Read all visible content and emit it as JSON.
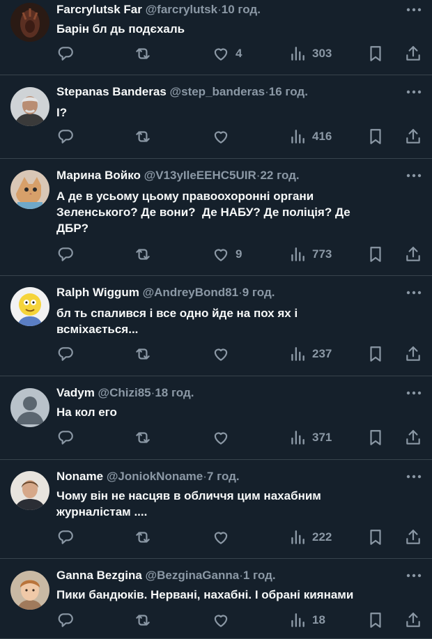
{
  "colors": {
    "background": "#15202b",
    "divider": "#38444d",
    "muted": "#8b98a5",
    "text": "#f7f9f9"
  },
  "tweets": [
    {
      "name": "Farcrylutsk Far",
      "handle": "@farcrylutsk",
      "sep": "·",
      "time": "10 год.",
      "text": "Барін бл дь подєхаль",
      "likes": "4",
      "views": "303",
      "avatar": "dark-figure-avatar"
    },
    {
      "name": "Stepanas Banderas",
      "handle": "@step_banderas",
      "sep": "·",
      "time": "16 год.",
      "text": "І?",
      "likes": "",
      "views": "416",
      "avatar": "man-gray-hair-avatar"
    },
    {
      "name": "Марина Войко",
      "handle": "@V13yIleEEHC5UIR",
      "sep": "·",
      "time": "22 год.",
      "text": "А де в усьому цьому правоохоронні органи\nЗеленського? Де вони?  Де НАБУ? Де поліція? Де\nДБР?",
      "likes": "9",
      "views": "773",
      "avatar": "kitten-avatar"
    },
    {
      "name": "Ralph Wiggum",
      "handle": "@AndreyBond81",
      "sep": "·",
      "time": "9 год.",
      "text": "бл ть спалився і все одно йде на пох ях і\nвсміхається...",
      "likes": "",
      "views": "237",
      "avatar": "cartoon-boy-avatar"
    },
    {
      "name": "Vadym",
      "handle": "@Chizi85",
      "sep": "·",
      "time": "18 год.",
      "text": "На кол его",
      "likes": "",
      "views": "371",
      "avatar": "default-profile-avatar"
    },
    {
      "name": "Noname",
      "handle": "@JoniokNoname",
      "sep": "·",
      "time": "7 год.",
      "text": "Чому він не насцяв в обличчя цим нахабним\nжурналістам ....",
      "likes": "",
      "views": "222",
      "avatar": "young-man-avatar"
    },
    {
      "name": "Ganna Bezgina",
      "handle": "@BezginaGanna",
      "sep": "·",
      "time": "1 год.",
      "text": "Пики бандюків. Нервані, нахабні. І обрані киянами",
      "likes": "",
      "views": "18",
      "avatar": "child-portrait-avatar"
    }
  ]
}
